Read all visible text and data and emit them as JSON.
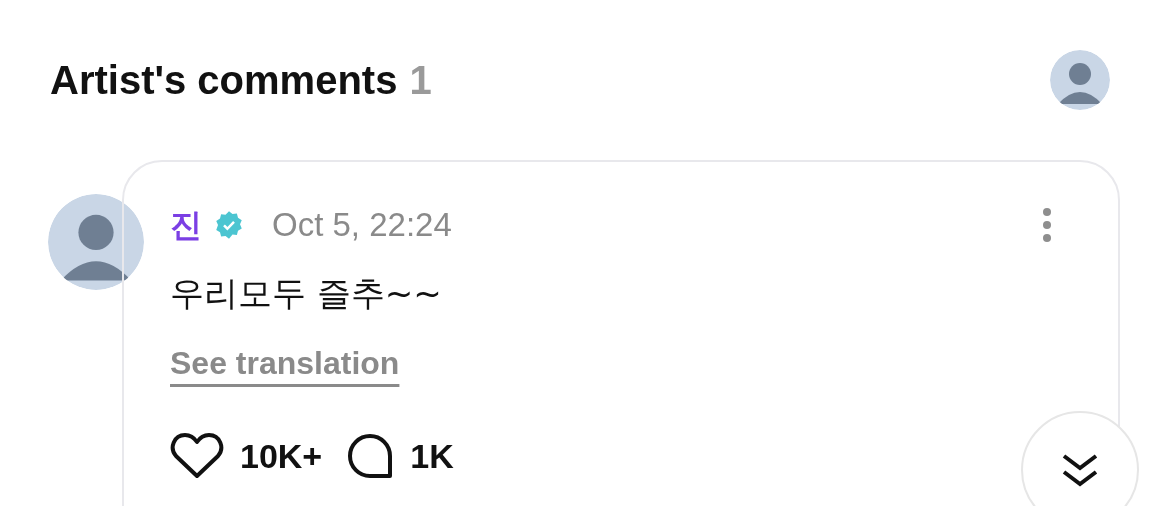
{
  "section": {
    "title": "Artist's comments",
    "count": "1"
  },
  "comment": {
    "author": "진",
    "verified": true,
    "time": "Oct 5, 22:24",
    "text": "우리모두 즐추~~",
    "translate_link": "See translation",
    "likes": "10K+",
    "replies": "1K"
  }
}
